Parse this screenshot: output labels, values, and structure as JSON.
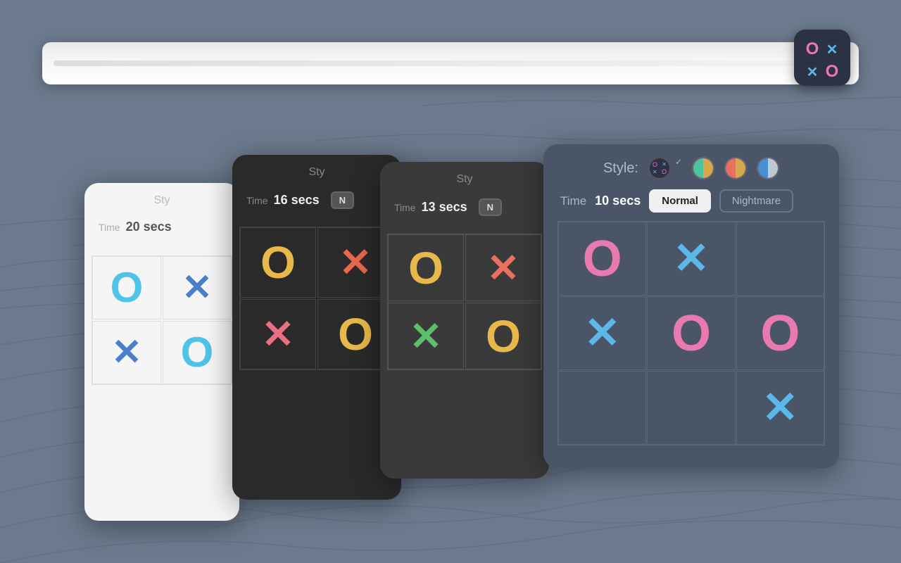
{
  "background": {
    "color": "#6b7a8d"
  },
  "app_icon": {
    "symbols": [
      {
        "char": "O",
        "color": "#e87ab0"
      },
      {
        "char": "✕",
        "color": "#5bb8e8"
      },
      {
        "char": "✕",
        "color": "#5bb8e8"
      },
      {
        "char": "O",
        "color": "#e87ab0"
      }
    ]
  },
  "cards": [
    {
      "id": "card-1",
      "theme": "light",
      "style_label": "Sty",
      "time_label": "Time",
      "time_value": "20 secs",
      "grid": [
        {
          "sym": "O",
          "color": "#4fc3e8",
          "row": 0,
          "col": 0
        },
        {
          "sym": "✕",
          "color": "#4a7fcb",
          "row": 0,
          "col": 1
        },
        {
          "sym": "✕",
          "color": "#4a7fcb",
          "row": 1,
          "col": 0
        },
        {
          "sym": "O",
          "color": "#4fc3e8",
          "row": 1,
          "col": 1
        }
      ]
    },
    {
      "id": "card-2",
      "theme": "dark",
      "style_label": "Sty",
      "time_label": "Time",
      "time_value": "16 secs",
      "grid": [
        {
          "sym": "O",
          "color": "#e8b84b",
          "row": 0,
          "col": 0
        },
        {
          "sym": "✕",
          "color": "#e8684b",
          "row": 0,
          "col": 1
        },
        {
          "sym": "✕",
          "color": "#e87080",
          "row": 1,
          "col": 0
        },
        {
          "sym": "O",
          "color": "#e8b84b",
          "row": 1,
          "col": 1
        }
      ]
    },
    {
      "id": "card-3",
      "theme": "dark",
      "style_label": "Sty",
      "time_label": "Time",
      "time_value": "13 secs",
      "grid": [
        {
          "sym": "O",
          "color": "#e8b84b",
          "row": 0,
          "col": 0
        },
        {
          "sym": "✕",
          "color": "#e87060",
          "row": 0,
          "col": 1
        },
        {
          "sym": "✕",
          "color": "#5cbf6a",
          "row": 1,
          "col": 0
        },
        {
          "sym": "O",
          "color": "#e8b84b",
          "row": 1,
          "col": 1
        }
      ]
    },
    {
      "id": "card-4",
      "theme": "blue-dark",
      "style_label": "Style:",
      "time_label": "Time",
      "time_value": "10 secs",
      "difficulty_normal": "Normal",
      "difficulty_nightmare": "Nightmare",
      "style_dots": [
        {
          "color": "#2c3244",
          "accent": "multi",
          "type": "dark-multi"
        },
        {
          "color": "#4fc3a0",
          "half": "#d4a84b"
        },
        {
          "color": "#e87060",
          "half": "#d4a84b"
        },
        {
          "color": "#4a8fd4",
          "half": "#c8c8c8"
        }
      ],
      "grid": [
        {
          "sym": "O",
          "color": "#e87ab0",
          "row": 0,
          "col": 0
        },
        {
          "sym": "✕",
          "color": "#5bb8e8",
          "row": 0,
          "col": 1
        },
        {
          "sym": "",
          "color": "",
          "row": 0,
          "col": 2
        },
        {
          "sym": "✕",
          "color": "#5bb8e8",
          "row": 1,
          "col": 0
        },
        {
          "sym": "O",
          "color": "#e87ab0",
          "row": 1,
          "col": 1
        },
        {
          "sym": "O",
          "color": "#e87ab0",
          "row": 1,
          "col": 2
        },
        {
          "sym": "",
          "color": "",
          "row": 2,
          "col": 0
        },
        {
          "sym": "",
          "color": "",
          "row": 2,
          "col": 1
        },
        {
          "sym": "✕",
          "color": "#5bb8e8",
          "row": 2,
          "col": 2
        }
      ]
    }
  ]
}
